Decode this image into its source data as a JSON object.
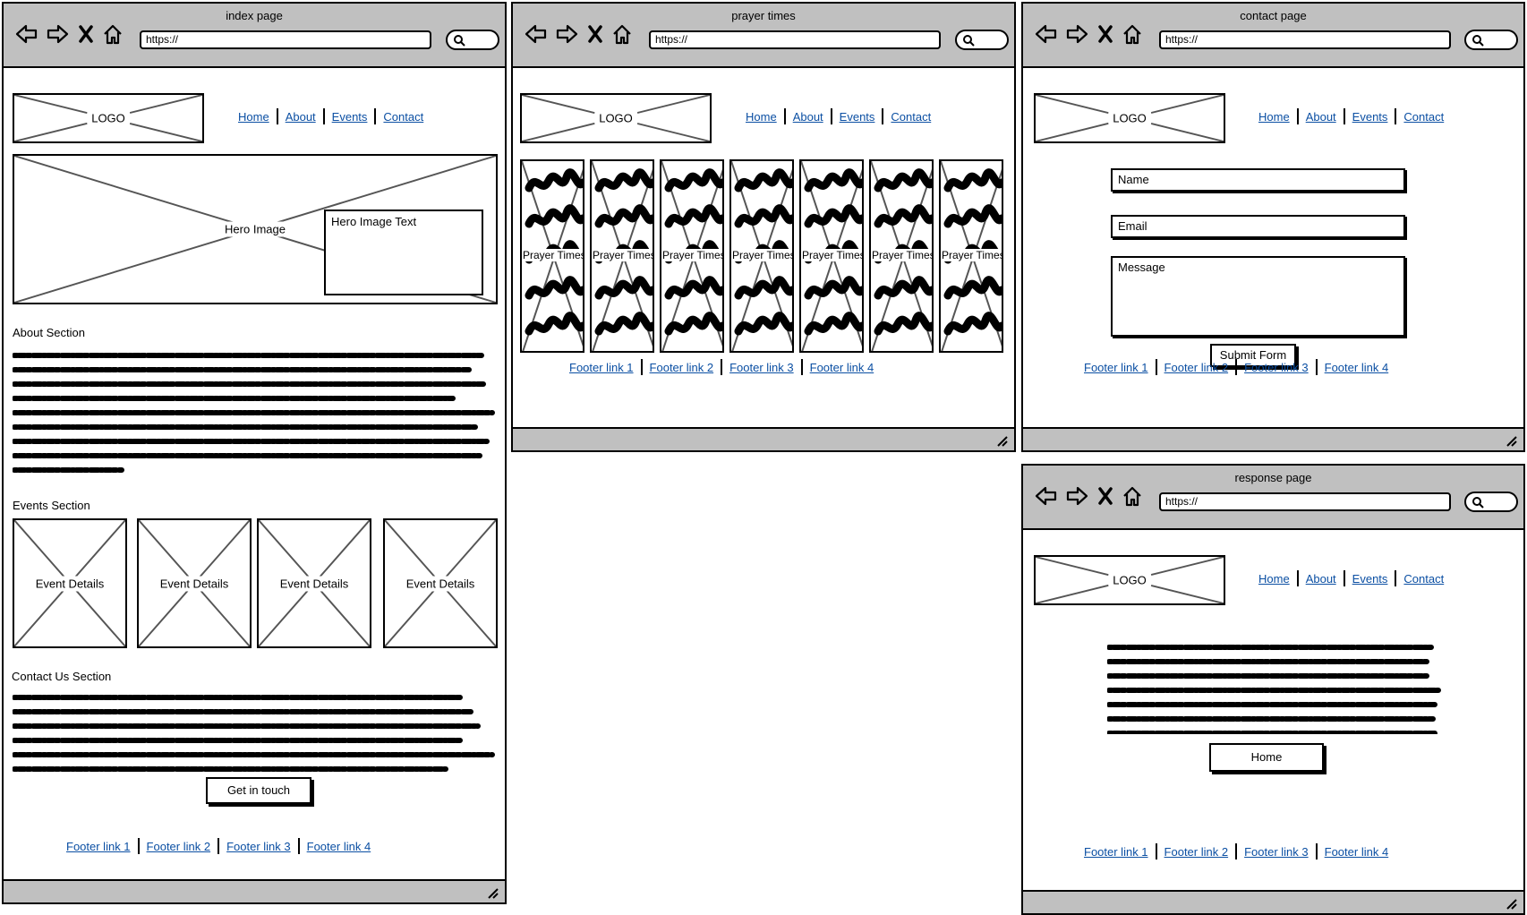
{
  "common": {
    "url": "https://",
    "logo": "LOGO",
    "nav": [
      "Home",
      "About",
      "Events",
      "Contact"
    ],
    "footer_links": [
      "Footer link 1",
      "Footer link 2",
      "Footer link 3",
      "Footer link 4"
    ]
  },
  "index": {
    "title": "index page",
    "hero_label": "Hero Image",
    "hero_text": "Hero Image Text",
    "about_heading": "About Section",
    "events_heading": "Events Section",
    "event_cards": [
      "Event Details",
      "Event Details",
      "Event Details",
      "Event Details"
    ],
    "contact_heading": "Contact Us Section",
    "cta_button": "Get in touch"
  },
  "prayer": {
    "title": "prayer times",
    "card_label": "Prayer Times",
    "card_count": 7
  },
  "contact": {
    "title": "contact page",
    "name_placeholder": "Name",
    "email_placeholder": "Email",
    "message_placeholder": "Message",
    "submit_button": "Submit Form"
  },
  "response": {
    "title": "response page",
    "home_button": "Home"
  }
}
